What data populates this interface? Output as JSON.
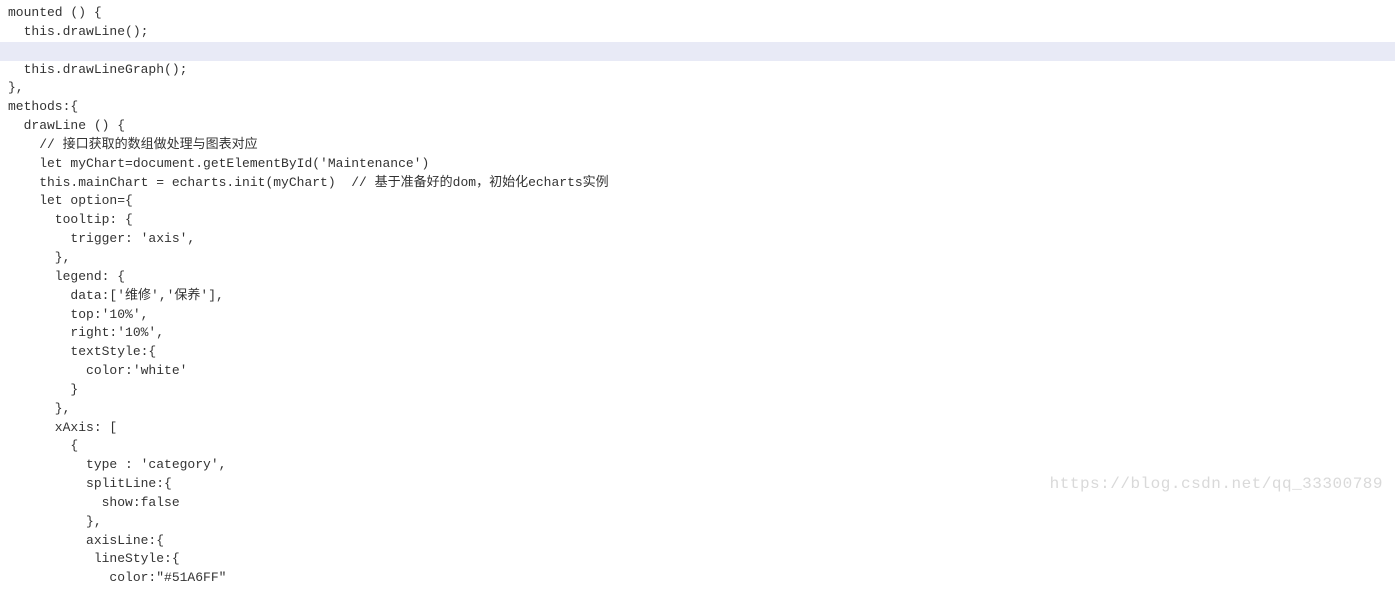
{
  "code": {
    "lines": [
      {
        "text": "mounted () {",
        "highlighted": false
      },
      {
        "text": "  this.drawLine();",
        "highlighted": false
      },
      {
        "text": "",
        "highlighted": true
      },
      {
        "text": "  this.drawLineGraph();",
        "highlighted": false
      },
      {
        "text": "},",
        "highlighted": false
      },
      {
        "text": "methods:{",
        "highlighted": false
      },
      {
        "text": "  drawLine () {",
        "highlighted": false
      },
      {
        "text": "    // 接口获取的数组做处理与图表对应",
        "highlighted": false
      },
      {
        "text": "    let myChart=document.getElementById('Maintenance')",
        "highlighted": false
      },
      {
        "text": "    this.mainChart = echarts.init(myChart)  // 基于准备好的dom，初始化echarts实例",
        "highlighted": false
      },
      {
        "text": "    let option={",
        "highlighted": false
      },
      {
        "text": "      tooltip: {",
        "highlighted": false
      },
      {
        "text": "        trigger: 'axis',",
        "highlighted": false
      },
      {
        "text": "      },",
        "highlighted": false
      },
      {
        "text": "      legend: {",
        "highlighted": false
      },
      {
        "text": "        data:['维修','保养'],",
        "highlighted": false
      },
      {
        "text": "        top:'10%',",
        "highlighted": false
      },
      {
        "text": "        right:'10%',",
        "highlighted": false
      },
      {
        "text": "        textStyle:{",
        "highlighted": false
      },
      {
        "text": "          color:'white'",
        "highlighted": false
      },
      {
        "text": "        }",
        "highlighted": false
      },
      {
        "text": "      },",
        "highlighted": false
      },
      {
        "text": "      xAxis: [",
        "highlighted": false
      },
      {
        "text": "        {",
        "highlighted": false
      },
      {
        "text": "          type : 'category',",
        "highlighted": false
      },
      {
        "text": "          splitLine:{",
        "highlighted": false
      },
      {
        "text": "            show:false",
        "highlighted": false
      },
      {
        "text": "          },",
        "highlighted": false
      },
      {
        "text": "          axisLine:{",
        "highlighted": false
      },
      {
        "text": "           lineStyle:{",
        "highlighted": false
      },
      {
        "text": "             color:\"#51A6FF\"",
        "highlighted": false
      }
    ]
  },
  "watermark": "https://blog.csdn.net/qq_33300789"
}
